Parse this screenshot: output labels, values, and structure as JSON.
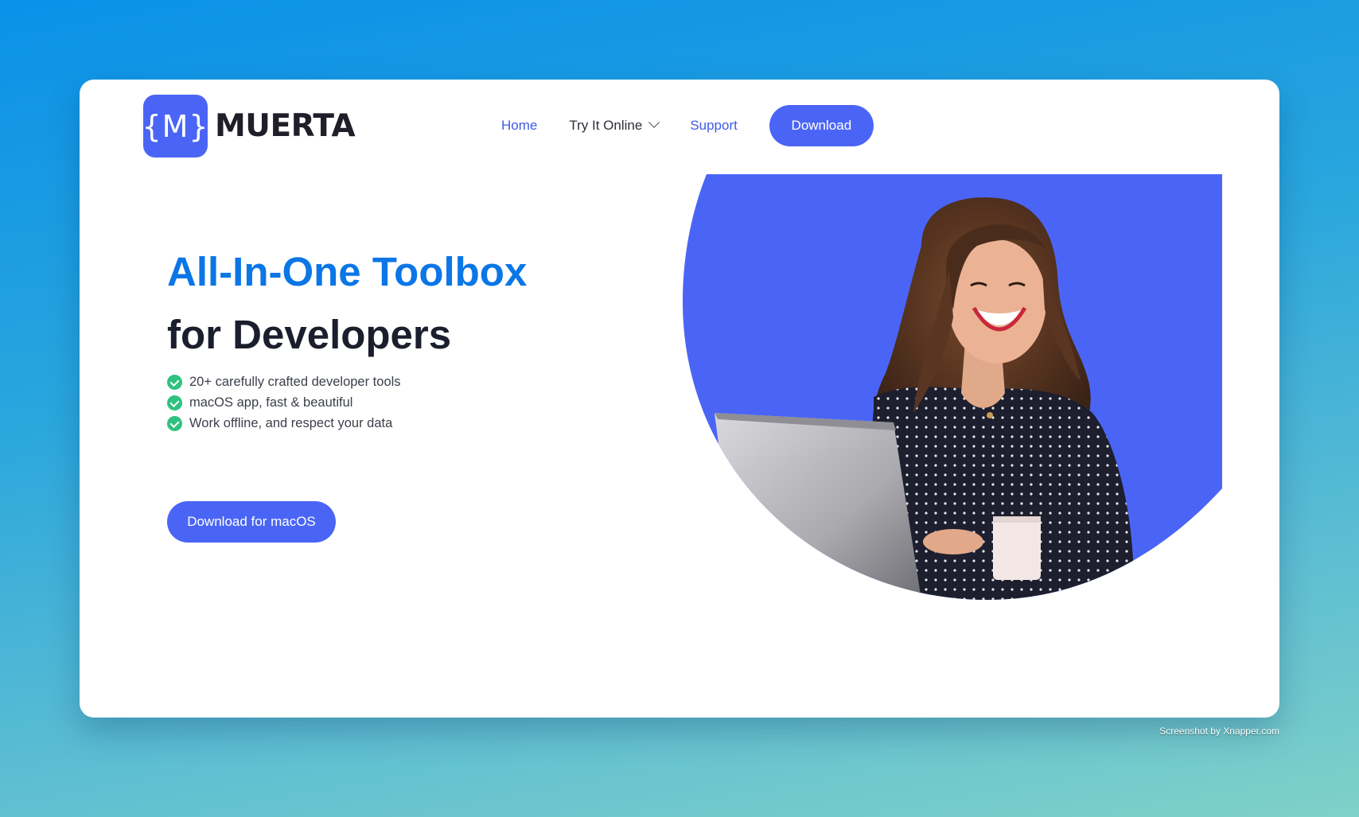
{
  "brand": {
    "logo_mark": "{M}",
    "name": "MUERTA",
    "accent": "#4a65f6"
  },
  "nav": {
    "home": "Home",
    "try_online": "Try It Online",
    "support": "Support",
    "download": "Download"
  },
  "hero": {
    "title_line1": "All-In-One Toolbox",
    "title_line2": "for Developers",
    "title_line1_color": "#0b76e6",
    "features": [
      "20+ carefully crafted developer tools",
      "macOS app, fast & beautiful",
      "Work offline, and respect your data"
    ],
    "cta": "Download for macOS"
  },
  "credit": "Screenshot by Xnapper.com"
}
